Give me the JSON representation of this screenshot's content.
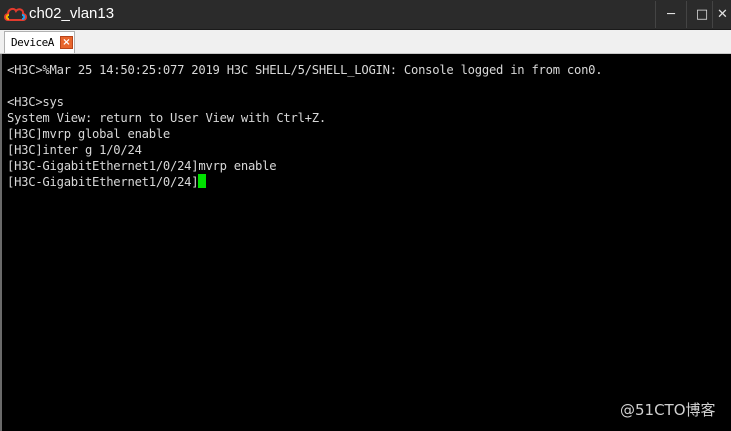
{
  "window": {
    "title": "ch02_vlan13",
    "minimize_glyph": "─",
    "maximize_glyph": "□",
    "close_glyph": "✕"
  },
  "tabs": [
    {
      "label": "DeviceA",
      "close_glyph": "×"
    }
  ],
  "terminal": {
    "lines": [
      "<H3C>%Mar 25 14:50:25:077 2019 H3C SHELL/5/SHELL_LOGIN: Console logged in from con0.",
      "",
      "<H3C>sys",
      "System View: return to User View with Ctrl+Z.",
      "[H3C]mvrp global enable",
      "[H3C]inter g 1/0/24",
      "[H3C-GigabitEthernet1/0/24]mvrp enable",
      "[H3C-GigabitEthernet1/0/24]"
    ],
    "text_color": "#d8d8d8",
    "background": "#000000",
    "cursor_color": "#00e000"
  },
  "watermark": "@51CTO博客",
  "icons": {
    "app": "cloud-logo-icon"
  }
}
